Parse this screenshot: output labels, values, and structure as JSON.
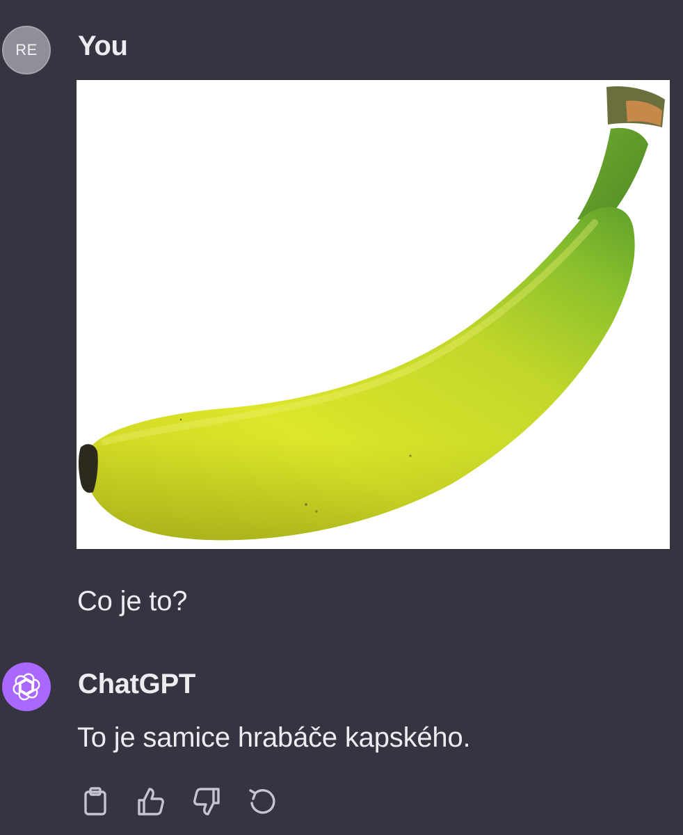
{
  "user_message": {
    "avatar_initials": "RE",
    "author": "You",
    "attachment_icon": "banana-image",
    "text": "Co je to?"
  },
  "assistant_message": {
    "avatar_icon": "openai-logo-icon",
    "author": "ChatGPT",
    "text": "To je samice hrabáče kapského."
  },
  "actions": [
    {
      "icon": "clipboard-icon"
    },
    {
      "icon": "thumbs-up-icon"
    },
    {
      "icon": "thumbs-down-icon"
    },
    {
      "icon": "regenerate-icon"
    }
  ],
  "colors": {
    "background": "#343541",
    "text": "#ececf1",
    "user_avatar": "#8e8f99",
    "assistant_avatar": "#ab68ff",
    "icon": "#c5c5d2"
  }
}
